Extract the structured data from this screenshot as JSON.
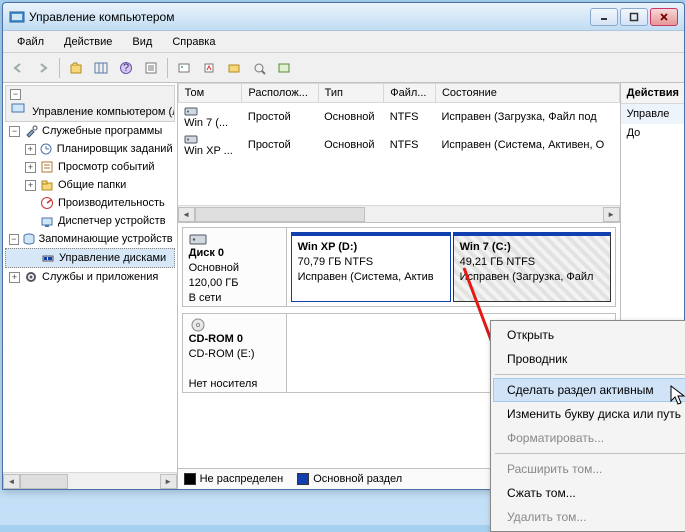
{
  "title": "Управление компьютером",
  "menu": {
    "file": "Файл",
    "action": "Действие",
    "view": "Вид",
    "help": "Справка"
  },
  "tree": {
    "header": "Управление компьютером (ло",
    "root_twisty": "−",
    "items": [
      {
        "twisty": "−",
        "label": "Служебные программы"
      },
      {
        "twisty": "+",
        "label": "Планировщик заданий",
        "indent": 1
      },
      {
        "twisty": "+",
        "label": "Просмотр событий",
        "indent": 1
      },
      {
        "twisty": "+",
        "label": "Общие папки",
        "indent": 1
      },
      {
        "twisty": "",
        "label": "Производительность",
        "indent": 1
      },
      {
        "twisty": "",
        "label": "Диспетчер устройств",
        "indent": 1
      },
      {
        "twisty": "−",
        "label": "Запоминающие устройств"
      },
      {
        "twisty": "",
        "label": "Управление дисками",
        "indent": 1,
        "selected": true
      },
      {
        "twisty": "+",
        "label": "Службы и приложения"
      }
    ]
  },
  "grid": {
    "cols": {
      "vol": "Том",
      "layout": "Располож...",
      "type": "Тип",
      "fs": "Файл...",
      "status": "Состояние"
    },
    "rows": [
      {
        "vol": "Win 7 (...",
        "layout": "Простой",
        "type": "Основной",
        "fs": "NTFS",
        "status": "Исправен (Загрузка, Файл под"
      },
      {
        "vol": "Win XP ...",
        "layout": "Простой",
        "type": "Основной",
        "fs": "NTFS",
        "status": "Исправен (Система, Активен, О"
      }
    ]
  },
  "disks": [
    {
      "name": "Диск 0",
      "kind": "Основной",
      "size": "120,00 ГБ",
      "state": "В сети",
      "parts": [
        {
          "title": "Win XP  (D:)",
          "line2": "70,79 ГБ NTFS",
          "line3": "Исправен (Система, Актив",
          "width": 160
        },
        {
          "title": "Win 7  (C:)",
          "line2": "49,21 ГБ NTFS",
          "line3": "Исправен (Загрузка, Файл ",
          "width": 158,
          "selected": true
        }
      ]
    },
    {
      "name": "CD-ROM 0",
      "line2": "CD-ROM (E:)",
      "state": "Нет носителя",
      "parts": []
    }
  ],
  "legend": {
    "unalloc": "Не распределен",
    "primary": "Основной раздел"
  },
  "actions": {
    "header": "Действия",
    "sub": "Управле",
    "more": "До"
  },
  "ctx": {
    "open": "Открыть",
    "explore": "Проводник",
    "make_active": "Сделать раздел активным",
    "change_letter": "Изменить букву диска или путь ...",
    "format": "Форматировать...",
    "extend": "Расширить том...",
    "shrink": "Сжать том...",
    "delete": "Удалить том..."
  }
}
